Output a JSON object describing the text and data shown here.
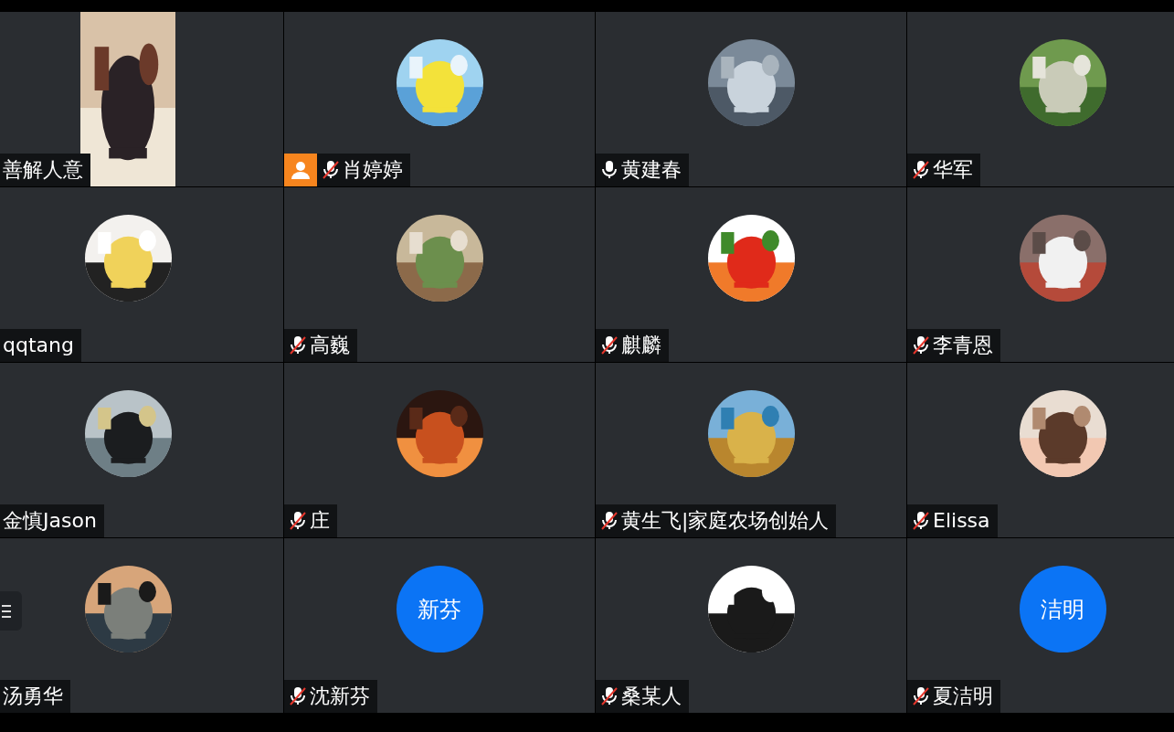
{
  "tiles": [
    {
      "name": "善解人意",
      "host": false,
      "avatar": {
        "kind": "video"
      }
    },
    {
      "name": "肖婷婷",
      "host": true,
      "muted": true
    },
    {
      "name": "黄建春",
      "host": false,
      "muted": false
    },
    {
      "name": "华军",
      "host": false,
      "muted": true
    },
    {
      "name": "qqtang",
      "host": false
    },
    {
      "name": "高巍",
      "host": false,
      "muted": true
    },
    {
      "name": "麒麟",
      "host": false,
      "muted": true
    },
    {
      "name": "李青恩",
      "host": false,
      "muted": true
    },
    {
      "name": "金慎Jason",
      "host": false
    },
    {
      "name": "庄",
      "host": false,
      "muted": true
    },
    {
      "name": "黄生飞|家庭农场创始人",
      "host": false,
      "muted": true
    },
    {
      "name": "Elissa",
      "host": false,
      "muted": true
    },
    {
      "name": "汤勇华",
      "host": false
    },
    {
      "name": "沈新芬",
      "host": false,
      "muted": true,
      "avatar": {
        "kind": "initials",
        "text": "新芬"
      }
    },
    {
      "name": "桑某人",
      "host": false,
      "muted": true
    },
    {
      "name": "夏洁明",
      "host": false,
      "muted": true,
      "avatar": {
        "kind": "initials",
        "text": "洁明"
      }
    }
  ]
}
